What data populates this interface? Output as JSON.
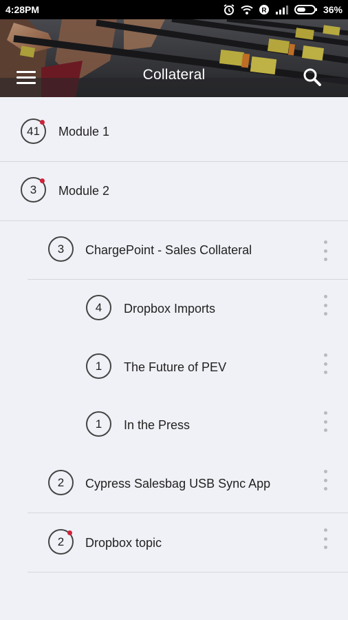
{
  "status_bar": {
    "time": "4:28PM",
    "battery": "36%"
  },
  "header": {
    "title": "Collateral"
  },
  "list": {
    "items": [
      {
        "label": "Module 1",
        "count": "41",
        "unread": true,
        "has_menu": false
      },
      {
        "label": "Module 2",
        "count": "3",
        "unread": true,
        "has_menu": false
      },
      {
        "label": "ChargePoint - Sales Collateral",
        "count": "3",
        "unread": false,
        "has_menu": true
      },
      {
        "label": "Dropbox Imports",
        "count": "4",
        "unread": false,
        "has_menu": true
      },
      {
        "label": "The Future of PEV",
        "count": "1",
        "unread": false,
        "has_menu": true
      },
      {
        "label": "In the Press",
        "count": "1",
        "unread": false,
        "has_menu": true
      },
      {
        "label": "Cypress Salesbag USB Sync App",
        "count": "2",
        "unread": false,
        "has_menu": true
      },
      {
        "label": "Dropbox topic",
        "count": "2",
        "unread": true,
        "has_menu": true
      }
    ]
  },
  "icons": {
    "menu": "hamburger-icon",
    "search": "search-icon",
    "more": "more-vert-icon",
    "alarm": "alarm-icon",
    "wifi": "wifi-icon",
    "battery": "battery-icon",
    "signal": "signal-icon"
  },
  "colors": {
    "background": "#f0f1f6",
    "unread_dot": "#d0233a",
    "divider": "#d6d7dc",
    "kebab": "#b9b9bf"
  }
}
